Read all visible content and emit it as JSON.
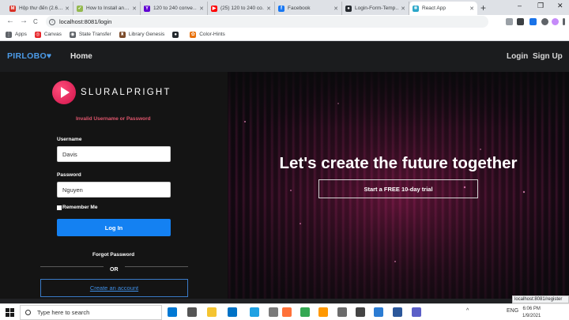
{
  "browser": {
    "tabs": [
      {
        "label": "Hộp thư đến (2.6…",
        "favicon": "gmail-icon",
        "color": "#d93025",
        "glyph": "M"
      },
      {
        "label": "How to Install an…",
        "favicon": "wikihow-icon",
        "color": "#93b84d",
        "glyph": "✓"
      },
      {
        "label": "120 to 240 conve…",
        "favicon": "yahoo-icon",
        "color": "#6001d2",
        "glyph": "Y"
      },
      {
        "label": "(25) 120 to 240 co…",
        "favicon": "youtube-icon",
        "color": "#ff0000",
        "glyph": "▶"
      },
      {
        "label": "Facebook",
        "favicon": "facebook-icon",
        "color": "#1877f2",
        "glyph": "f"
      },
      {
        "label": "Login-Form-Temp…",
        "favicon": "github-icon",
        "color": "#24292e",
        "glyph": "●"
      },
      {
        "label": "React App",
        "favicon": "react-icon",
        "color": "#2ba7c9",
        "glyph": "⚛"
      }
    ],
    "new_tab_glyph": "+",
    "window_controls": {
      "minimize": "–",
      "maximize": "❐",
      "close": "✕"
    },
    "nav": {
      "back": "←",
      "forward": "→",
      "reload": "C"
    },
    "url": "localhost:8081/login",
    "info_glyph": "i",
    "bookmarks": [
      {
        "label": "Apps",
        "icon": "apps-grid-icon",
        "color": "#5f6368",
        "glyph": "⋮"
      },
      {
        "label": "Canvas",
        "icon": "canvas-icon",
        "color": "#e72429",
        "glyph": "◎"
      },
      {
        "label": "State Transfer",
        "icon": "globe-icon",
        "color": "#5f6368",
        "glyph": "◉"
      },
      {
        "label": "Library Genesis",
        "icon": "library-icon",
        "color": "#7b4b2a",
        "glyph": "♜"
      },
      {
        "label": "",
        "icon": "github-icon",
        "color": "#24292e",
        "glyph": "●"
      },
      {
        "label": "Color-Hints",
        "icon": "color-hints-icon",
        "color": "#e8710a",
        "glyph": "✿"
      }
    ],
    "status_url": "localhost:8081/register"
  },
  "app": {
    "brand": "PIRLOBO♥",
    "nav_home": "Home",
    "nav_login": "Login",
    "nav_signup": "Sign Up"
  },
  "login": {
    "logo_text": "SLURALPRIGHT",
    "error": "Invalid Username or Password",
    "username_label": "Username",
    "username_value": "Davis",
    "password_label": "Password",
    "password_value": "Nguyen",
    "remember_label": "Remember Me",
    "login_button": "Log In",
    "forgot": "Forgot Password",
    "or": "OR",
    "create_account": "Create an account"
  },
  "hero": {
    "title": "Let's create the future together",
    "trial_button": "Start a FREE 10-day trial"
  },
  "taskbar": {
    "search_placeholder": "Type here to search",
    "apps": [
      {
        "icon": "vscode-icon",
        "color": "#0078d4"
      },
      {
        "icon": "task-view-icon",
        "color": "#555555"
      },
      {
        "icon": "file-explorer-icon",
        "color": "#f4c431"
      },
      {
        "icon": "mail-icon",
        "color": "#0072c6"
      },
      {
        "icon": "edge-icon",
        "color": "#1fa1e3"
      },
      {
        "icon": "snipping-tool-icon",
        "color": "#7a7a7a"
      },
      {
        "icon": "firefox-icon",
        "color": "#ff7139"
      },
      {
        "icon": "chrome-icon",
        "color": "#34a853"
      },
      {
        "icon": "sublime-icon",
        "color": "#ff9800"
      },
      {
        "icon": "store-icon",
        "color": "#6b6b6b"
      },
      {
        "icon": "settings-icon",
        "color": "#444444"
      },
      {
        "icon": "git-icon",
        "color": "#2b7cd3"
      },
      {
        "icon": "word-icon",
        "color": "#2b579a"
      },
      {
        "icon": "teams-icon",
        "color": "#5b5fc7"
      }
    ],
    "tray_lang": "ENG",
    "time": "6:06 PM",
    "date": "1/9/2021"
  }
}
